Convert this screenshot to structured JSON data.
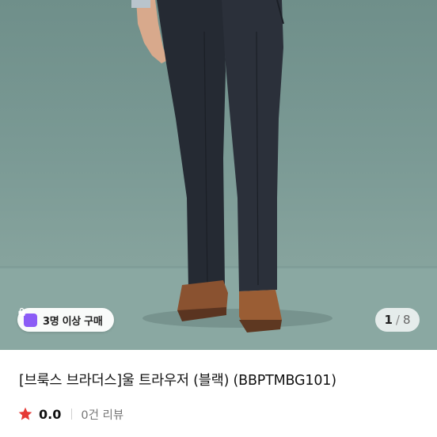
{
  "product_image": {
    "alt_icon": "product-photo",
    "promo_badge": {
      "icon": "shopping-bag-icon",
      "label": "3명 이상 구매",
      "icon_color": "#8b5cf6"
    },
    "pager": {
      "current": "1",
      "separator": "/",
      "total": "8"
    }
  },
  "product": {
    "title": "[브룩스 브라더스]울 트라우저 (블랙) (BBPTMBG101)",
    "rating": "0.0",
    "review_count_text": "0건 리뷰",
    "star_color": "#e53935"
  }
}
